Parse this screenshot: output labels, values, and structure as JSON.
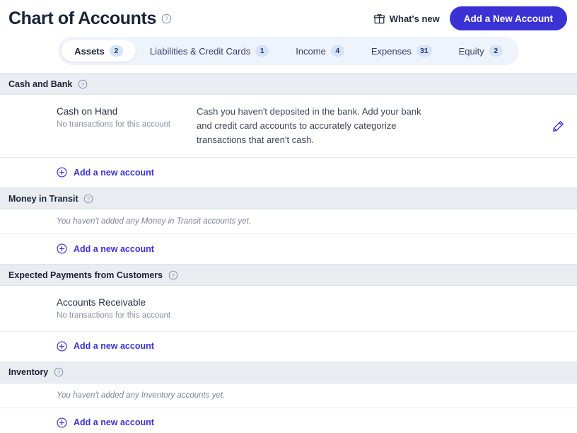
{
  "header": {
    "title": "Chart of Accounts",
    "help_icon": "help-circle-icon",
    "whats_new_label": "What's new",
    "whats_new_icon": "gift-icon",
    "primary_button_label": "Add a New Account",
    "primary_button_color": "#3b32d6"
  },
  "tabs": [
    {
      "label": "Assets",
      "count": "2",
      "active": true
    },
    {
      "label": "Liabilities & Credit Cards",
      "count": "1",
      "active": false
    },
    {
      "label": "Income",
      "count": "4",
      "active": false
    },
    {
      "label": "Expenses",
      "count": "31",
      "active": false
    },
    {
      "label": "Equity",
      "count": "2",
      "active": false
    }
  ],
  "add_account_label": "Add a new account",
  "sections": [
    {
      "title": "Cash and Bank",
      "help_icon": "help-circle-icon",
      "accounts": [
        {
          "name": "Cash on Hand",
          "sub": "No transactions for this account",
          "description": "Cash you haven't deposited in the bank. Add your bank and credit card accounts to accurately categorize transactions that aren't cash.",
          "edit_icon": "pencil-icon"
        }
      ],
      "empty_text": ""
    },
    {
      "title": "Money in Transit",
      "help_icon": "help-circle-icon",
      "accounts": [],
      "empty_text": "You haven't added any Money in Transit accounts yet."
    },
    {
      "title": "Expected Payments from Customers",
      "help_icon": "help-circle-icon",
      "accounts": [
        {
          "name": "Accounts Receivable",
          "sub": "No transactions for this account",
          "description": "",
          "edit_icon": ""
        }
      ],
      "empty_text": ""
    },
    {
      "title": "Inventory",
      "help_icon": "help-circle-icon",
      "accounts": [],
      "empty_text": "You haven't added any Inventory accounts yet."
    }
  ]
}
